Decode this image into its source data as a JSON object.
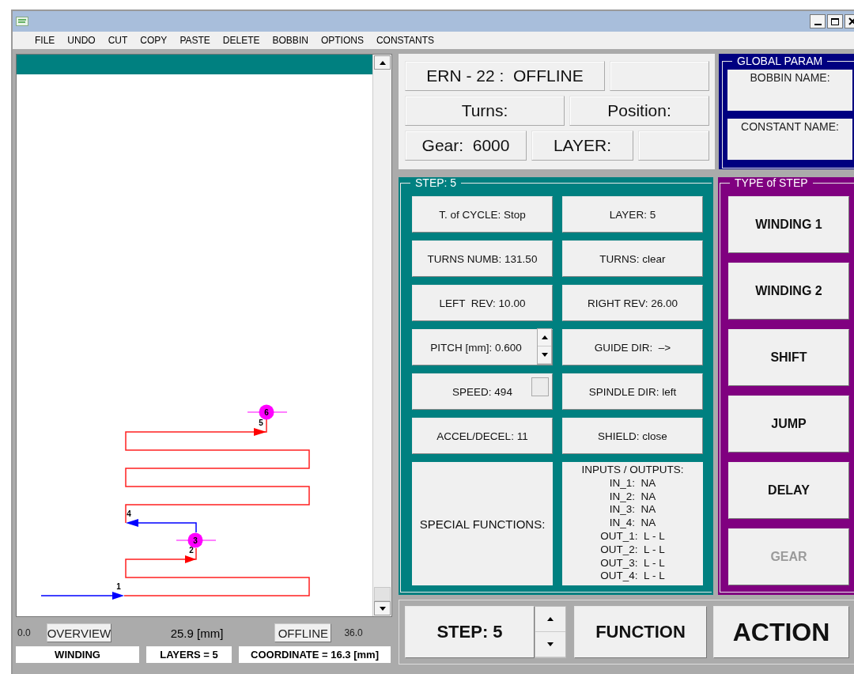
{
  "menu": [
    {
      "label": "FILE"
    },
    {
      "label": "UNDO"
    },
    {
      "label": "CUT"
    },
    {
      "label": "COPY"
    },
    {
      "label": "PASTE"
    },
    {
      "label": "DELETE"
    },
    {
      "label": "BOBBIN"
    },
    {
      "label": "OPTIONS"
    },
    {
      "label": "CONSTANTS"
    }
  ],
  "diagram": {
    "points": [
      {
        "label": "1",
        "kind": "label"
      },
      {
        "label": "2",
        "kind": "label"
      },
      {
        "label": "3",
        "kind": "marker"
      },
      {
        "label": "4",
        "kind": "label"
      },
      {
        "label": "5",
        "kind": "label"
      },
      {
        "label": "6",
        "kind": "marker"
      }
    ]
  },
  "scale": {
    "min": "0.0",
    "overview": "OVERVIEW",
    "center": "25.9 [mm]",
    "offline": "OFFLINE",
    "max": "36.0"
  },
  "status": [
    "WINDING",
    "LAYERS = 5",
    "COORDINATE = 16.3 [mm]"
  ],
  "machine": {
    "title": "ERN - 22 :  OFFLINE",
    "turns": "Turns:",
    "position": "Position:",
    "gear": "Gear:  6000",
    "layer": "LAYER:"
  },
  "global_param": {
    "title": "GLOBAL PARAM",
    "fields": [
      "BOBBIN NAME:",
      "CONSTANT NAME:"
    ]
  },
  "step_panel": {
    "title": "STEP: 5",
    "params": [
      {
        "label": "T. of CYCLE: Stop",
        "kind": "plain"
      },
      {
        "label": "LAYER: 5",
        "kind": "plain"
      },
      {
        "label": "TURNS NUMB: 131.50",
        "kind": "plain"
      },
      {
        "label": "TURNS: clear",
        "kind": "plain"
      },
      {
        "label": "LEFT  REV: 10.00",
        "kind": "plain"
      },
      {
        "label": "RIGHT REV: 26.00",
        "kind": "plain"
      },
      {
        "label": "PITCH [mm]: 0.600",
        "kind": "spinner"
      },
      {
        "label": "GUIDE DIR:  –>",
        "kind": "plain"
      },
      {
        "label": "SPEED: 494",
        "kind": "toggle"
      },
      {
        "label": "SPINDLE DIR: left",
        "kind": "plain"
      },
      {
        "label": "ACCEL/DECEL: 11",
        "kind": "plain"
      },
      {
        "label": "SHIELD: close",
        "kind": "plain"
      }
    ],
    "special": "SPECIAL FUNCTIONS:",
    "io": {
      "title": "INPUTS / OUTPUTS:",
      "lines": [
        "IN_1:  NA",
        "IN_2:  NA",
        "IN_3:  NA",
        "IN_4:  NA",
        "OUT_1:  L - L",
        "OUT_2:  L - L",
        "OUT_3:  L - L",
        "OUT_4:  L - L"
      ]
    }
  },
  "type_of_step": {
    "title": "TYPE of STEP",
    "items": [
      {
        "label": "WINDING 1",
        "disabled": false
      },
      {
        "label": "WINDING 2",
        "disabled": false
      },
      {
        "label": "SHIFT",
        "disabled": false
      },
      {
        "label": "JUMP",
        "disabled": false
      },
      {
        "label": "DELAY",
        "disabled": false
      },
      {
        "label": "GEAR",
        "disabled": true
      }
    ]
  },
  "footer": {
    "step": "STEP: 5",
    "function": "FUNCTION",
    "action": "ACTION"
  }
}
